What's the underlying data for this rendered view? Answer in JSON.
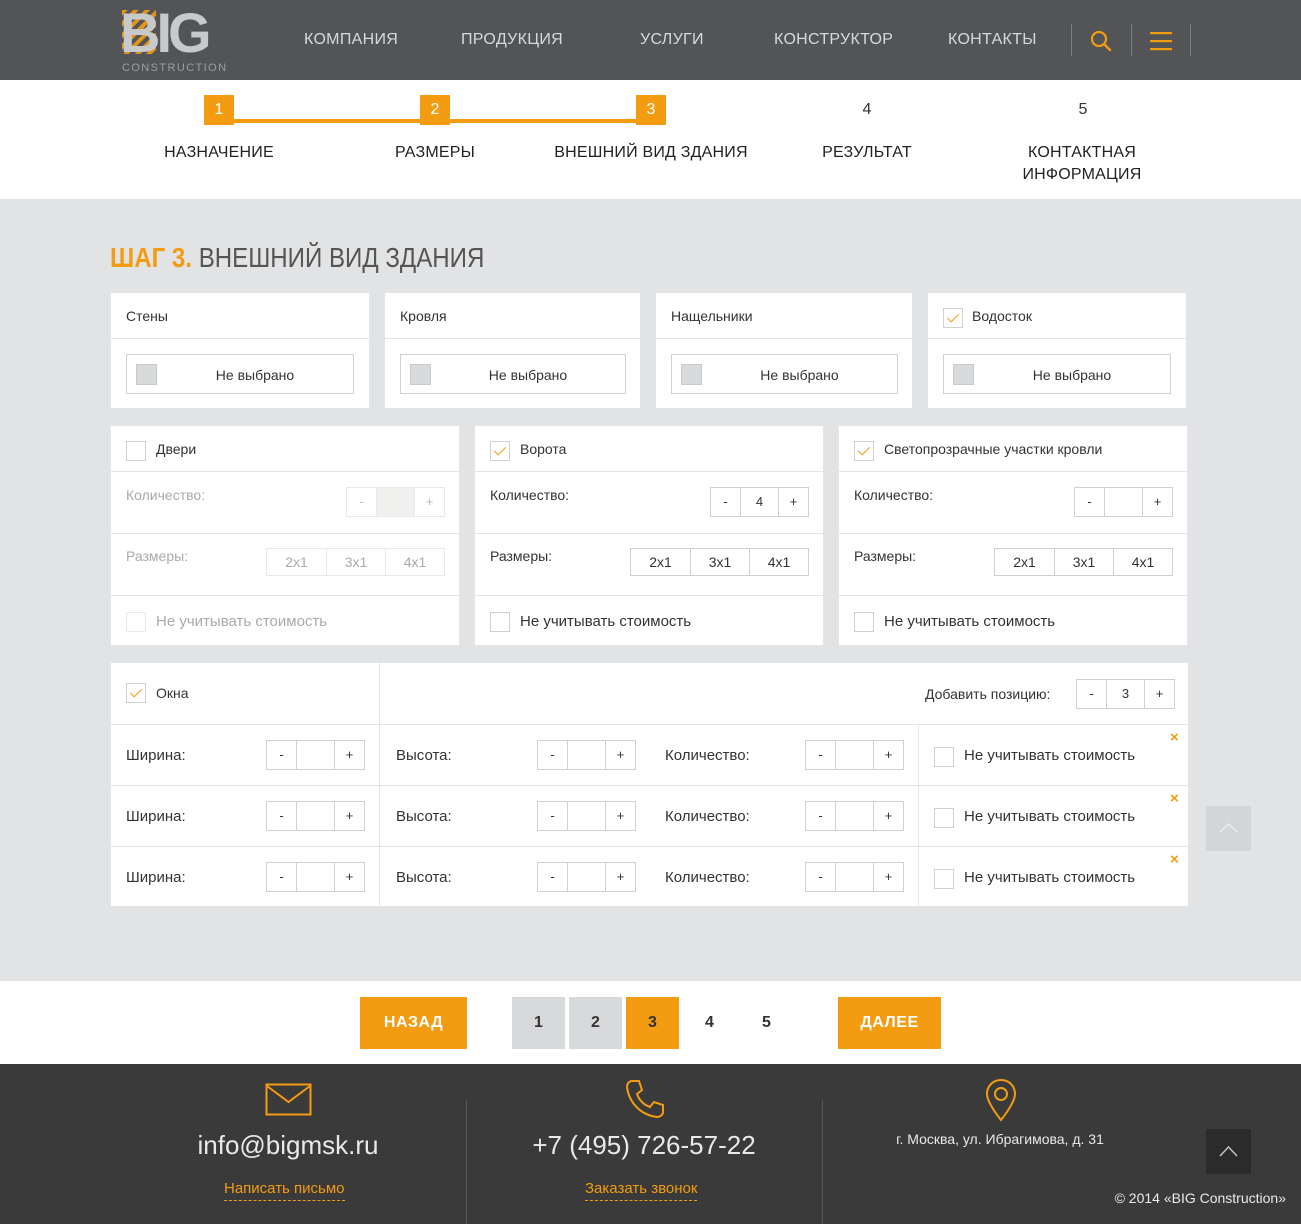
{
  "header": {
    "logo_main": "BIG",
    "logo_sub": "CONSTRUCTION",
    "nav": [
      "КОМПАНИЯ",
      "ПРОДУКЦИЯ",
      "УСЛУГИ",
      "КОНСТРУКТОР",
      "КОНТАКТЫ"
    ]
  },
  "steps": [
    {
      "num": "1",
      "label": "НАЗНАЧЕНИЕ"
    },
    {
      "num": "2",
      "label": "РАЗМЕРЫ"
    },
    {
      "num": "3",
      "label": "ВНЕШНИЙ ВИД ЗДАНИЯ"
    },
    {
      "num": "4",
      "label": "РЕЗУЛЬТАТ"
    },
    {
      "num": "5",
      "label": "КОНТАКТНАЯ ИНФОРМАЦИЯ"
    }
  ],
  "page_title": {
    "step": "ШАГ 3.",
    "text": "ВНЕШНИЙ ВИД ЗДАНИЯ"
  },
  "materials": [
    {
      "title": "Стены",
      "checked": false,
      "value": "Не выбрано"
    },
    {
      "title": "Кровля",
      "checked": false,
      "value": "Не выбрано"
    },
    {
      "title": "Нащельники",
      "checked": false,
      "value": "Не выбрано"
    },
    {
      "title": "Водосток",
      "checked": true,
      "value": "Не выбрано"
    }
  ],
  "options": [
    {
      "title": "Двери",
      "checked": false,
      "qty_label": "Количество:",
      "qty": "",
      "minus": "-",
      "plus": "+",
      "size_label": "Размеры:",
      "sizes": [
        "2x1",
        "3x1",
        "4x1"
      ],
      "ignore": "Не учитывать стоимость"
    },
    {
      "title": "Ворота",
      "checked": true,
      "qty_label": "Количество:",
      "qty": "4",
      "minus": "-",
      "plus": "+",
      "size_label": "Размеры:",
      "sizes": [
        "2x1",
        "3x1",
        "4x1"
      ],
      "ignore": "Не учитывать стоимость"
    },
    {
      "title": "Светопрозрачные участки кровли",
      "checked": true,
      "qty_label": "Количество:",
      "qty": "",
      "minus": "-",
      "plus": "+",
      "size_label": "Размеры:",
      "sizes": [
        "2x1",
        "3x1",
        "4x1"
      ],
      "ignore": "Не учитывать стоимость"
    }
  ],
  "windows": {
    "title": "Окна",
    "checked": true,
    "add_label": "Добавить позицию:",
    "add_value": "3",
    "minus": "-",
    "plus": "+",
    "close": "×",
    "rows": [
      {
        "width_label": "Ширина:",
        "width": "",
        "height_label": "Высота:",
        "height": "",
        "qty_label": "Количество:",
        "qty": "",
        "ignore": "Не учитывать стоимость"
      },
      {
        "width_label": "Ширина:",
        "width": "",
        "height_label": "Высота:",
        "height": "",
        "qty_label": "Количество:",
        "qty": "",
        "ignore": "Не учитывать стоимость"
      },
      {
        "width_label": "Ширина:",
        "width": "",
        "height_label": "Высота:",
        "height": "",
        "qty_label": "Количество:",
        "qty": "",
        "ignore": "Не учитывать стоимость"
      }
    ]
  },
  "pager": {
    "back": "НАЗАД",
    "next": "ДАЛЕЕ",
    "pages": [
      "1",
      "2",
      "3",
      "4",
      "5"
    ],
    "current": "3"
  },
  "footer": {
    "email": "info@bigmsk.ru",
    "email_link": "Написать письмо",
    "phone": "+7 (495) 726-57-22",
    "phone_link": "Заказать звонок",
    "address": "г. Москва, ул. Ибрагимова, д. 31",
    "copyright": "© 2014 «BIG Construction»"
  },
  "colors": {
    "accent": "#f39c12",
    "header_bg": "#535456",
    "footer_bg": "#3a3a3b",
    "page_bg": "#e2e3e5"
  }
}
